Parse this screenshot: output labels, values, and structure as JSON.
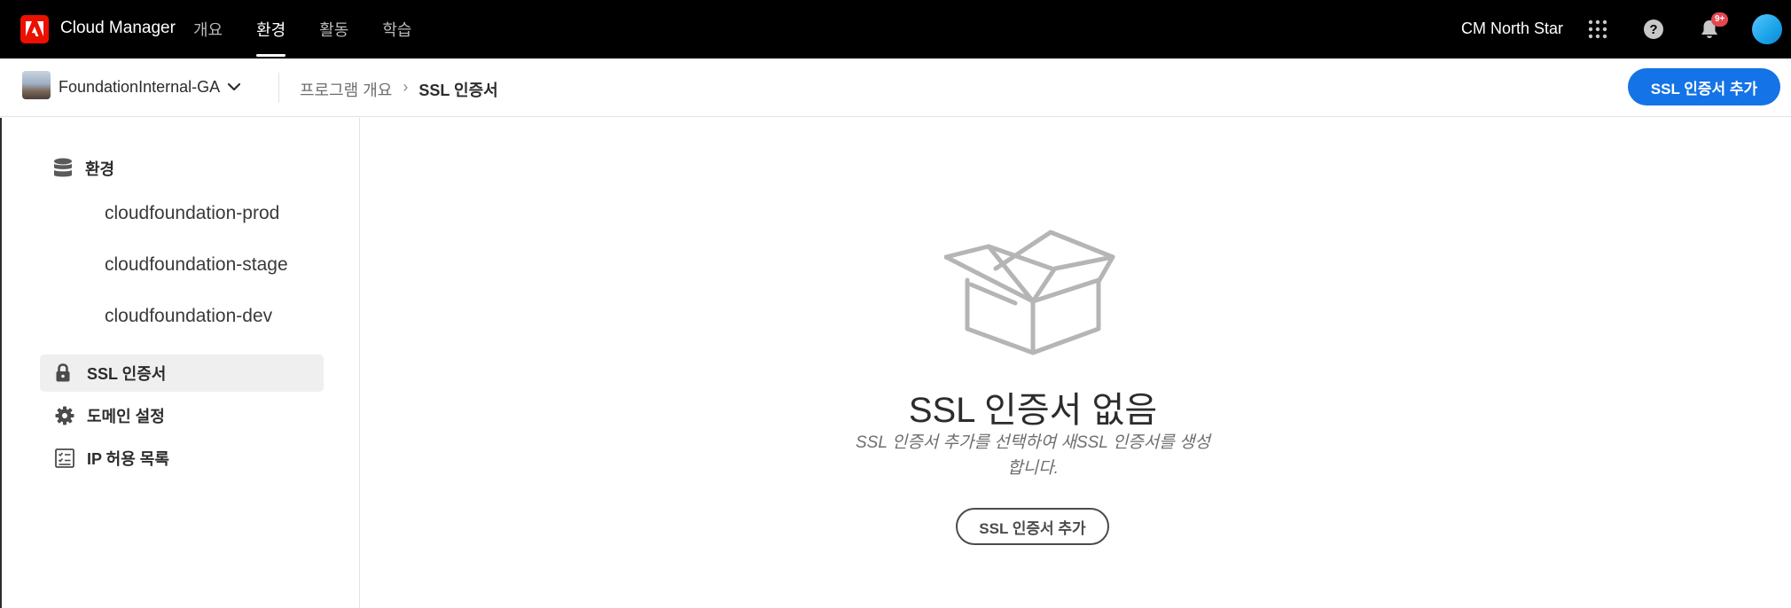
{
  "app": {
    "title": "Cloud Manager",
    "brand_color": "#eb1000"
  },
  "topnav": {
    "items": [
      {
        "label": "개요",
        "active": false
      },
      {
        "label": "환경",
        "active": true
      },
      {
        "label": "활동",
        "active": false
      },
      {
        "label": "학습",
        "active": false
      }
    ],
    "org_name": "CM North Star",
    "notification_badge": "9+",
    "icons": [
      "apps-grid-icon",
      "help-icon",
      "bell-icon"
    ]
  },
  "subbar": {
    "program_name": "FoundationInternal-GA",
    "breadcrumb": {
      "parent": "프로그램 개요",
      "separator": "›",
      "current": "SSL 인증서"
    },
    "primary_action": "SSL 인증서 추가",
    "accent_color": "#1473e6"
  },
  "sidebar": {
    "environments_header": "환경",
    "environments": [
      "cloudfoundation-prod",
      "cloudfoundation-stage",
      "cloudfoundation-dev"
    ],
    "items": [
      {
        "label": "SSL 인증서",
        "icon": "lock-icon",
        "selected": true
      },
      {
        "label": "도메인 설정",
        "icon": "gear-icon",
        "selected": false
      },
      {
        "label": "IP 허용 목록",
        "icon": "checklist-icon",
        "selected": false
      }
    ]
  },
  "empty_state": {
    "illustration": "open-box-icon",
    "title": "SSL 인증서 없음",
    "description": "SSL 인증서 추가를 선택하여 새SSL 인증서를 생성합니다.",
    "action": "SSL 인증서 추가"
  }
}
